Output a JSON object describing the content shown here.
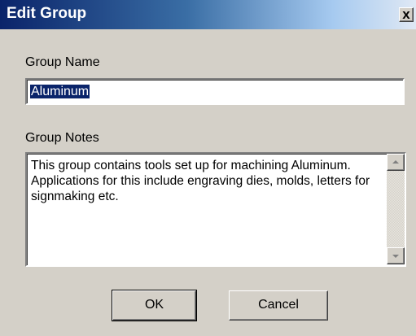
{
  "window": {
    "title": "Edit Group",
    "close_glyph": "x"
  },
  "group_name": {
    "label": "Group Name",
    "value": "Aluminum"
  },
  "group_notes": {
    "label": "Group Notes",
    "value": "This group contains tools set up for machining Aluminum. Applications for this include engraving dies, molds, letters for signmaking etc."
  },
  "buttons": {
    "ok_label": "OK",
    "cancel_label": "Cancel"
  },
  "colors": {
    "titlebar_start": "#0a246a",
    "dialog_bg": "#d4d0c8",
    "selection_bg": "#0a246a"
  },
  "icons": {
    "close": "close-icon",
    "scroll_up": "arrow-up-icon",
    "scroll_down": "arrow-down-icon"
  }
}
